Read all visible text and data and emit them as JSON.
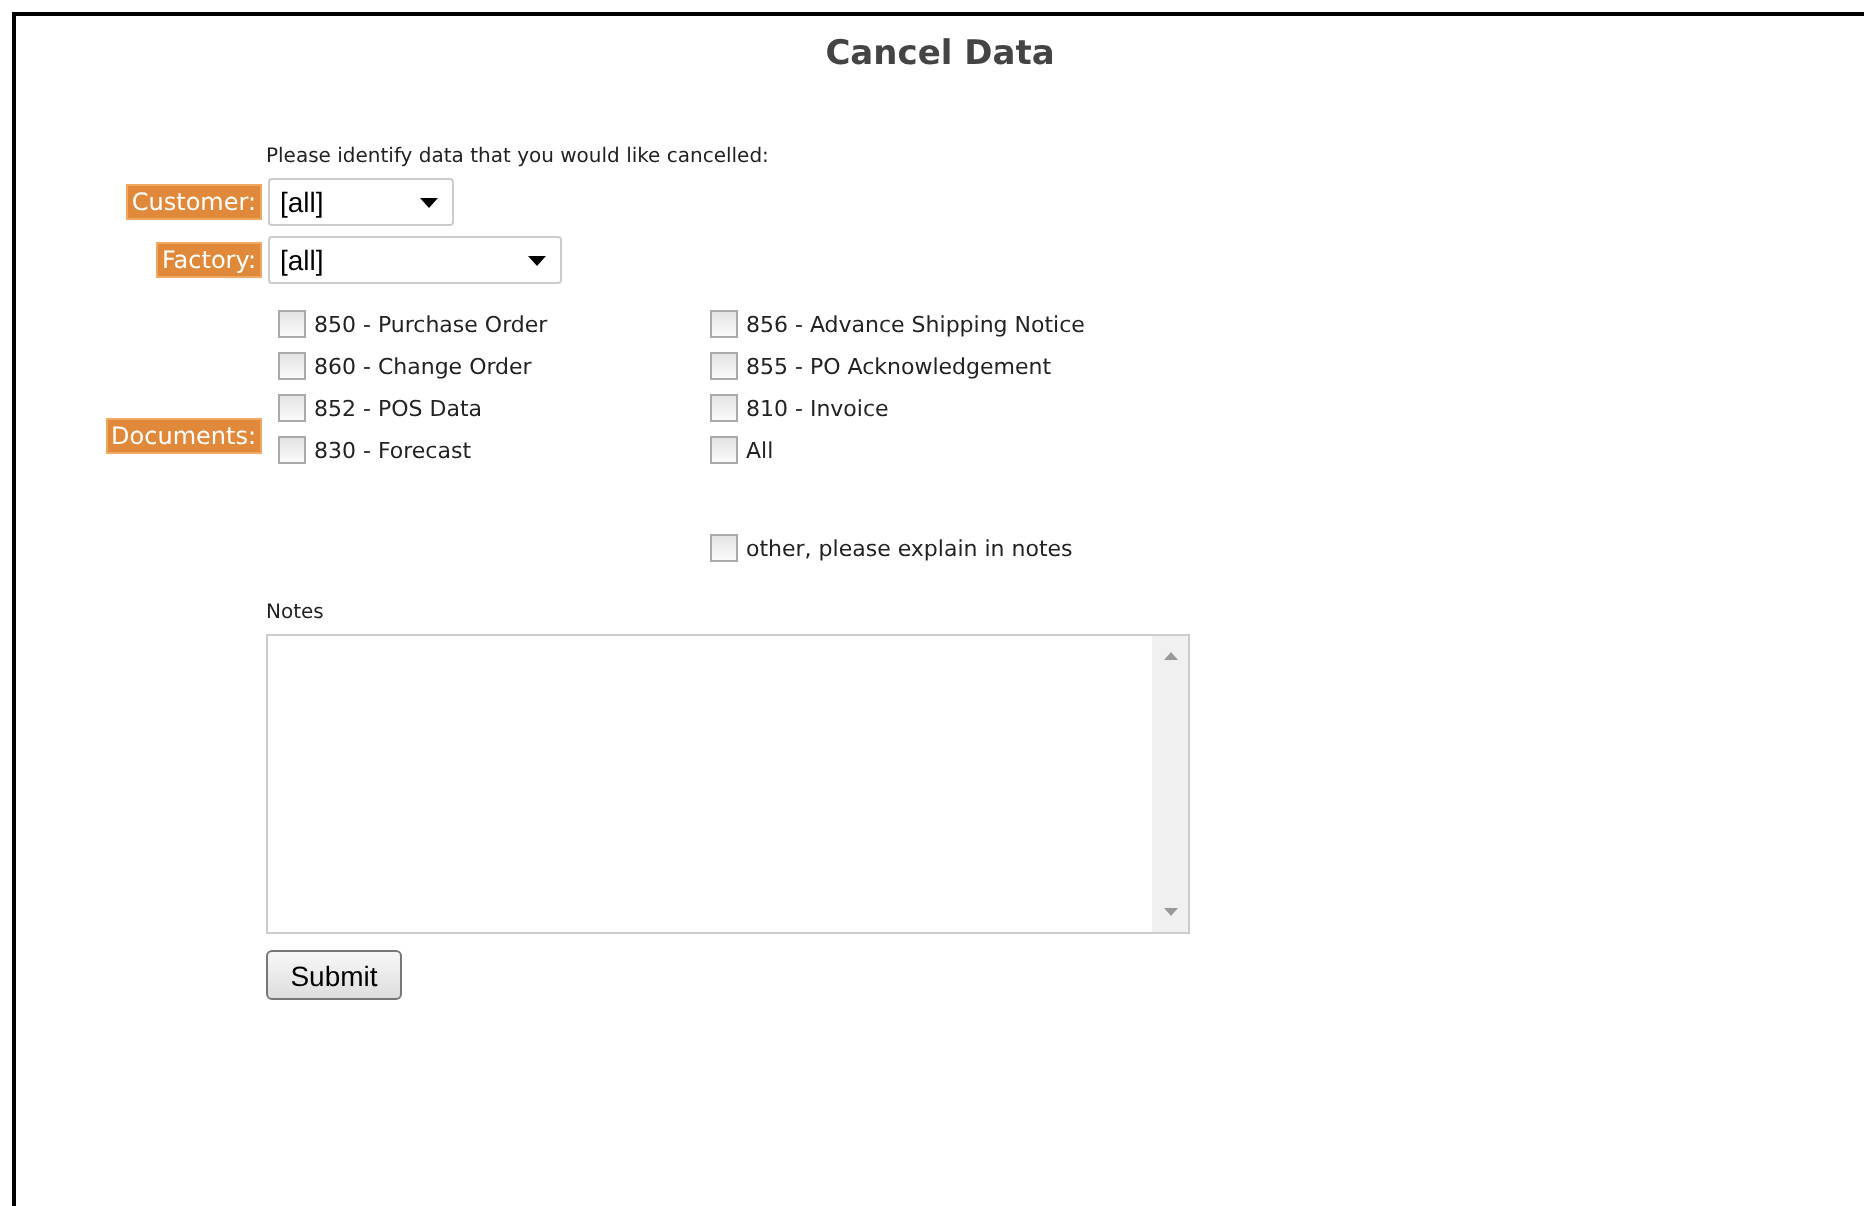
{
  "title": "Cancel Data",
  "instruction": "Please identify data that you would like cancelled:",
  "customer": {
    "label": "Customer:",
    "value": "[all]"
  },
  "factory": {
    "label": "Factory:",
    "value": "[all]"
  },
  "documents": {
    "label": "Documents:",
    "options": [
      {
        "label": "850 - Purchase Order",
        "checked": false
      },
      {
        "label": "856 - Advance Shipping Notice",
        "checked": false
      },
      {
        "label": "860 - Change Order",
        "checked": false
      },
      {
        "label": "855 - PO Acknowledgement",
        "checked": false
      },
      {
        "label": "852 - POS Data",
        "checked": false
      },
      {
        "label": "810 - Invoice",
        "checked": false
      },
      {
        "label": "830 - Forecast",
        "checked": false
      },
      {
        "label": "All",
        "checked": false
      }
    ]
  },
  "other": {
    "label": "other, please explain in notes",
    "checked": false
  },
  "notes": {
    "label": "Notes"
  },
  "submit": "Submit"
}
